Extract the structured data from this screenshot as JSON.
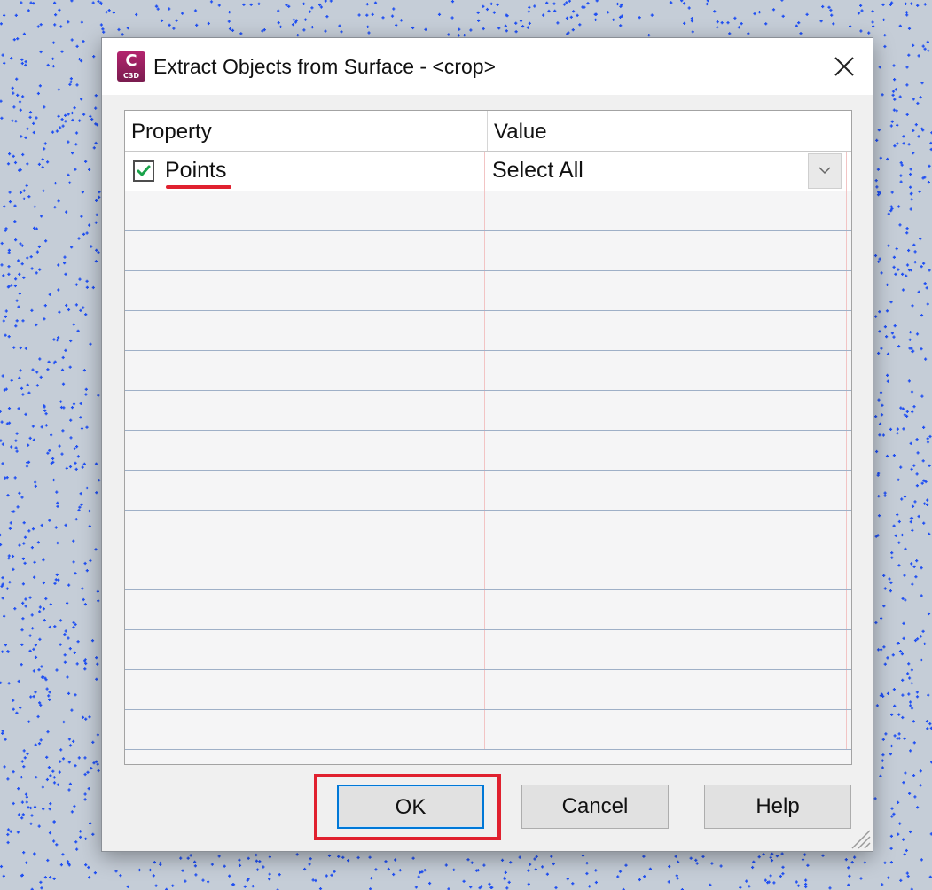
{
  "window": {
    "title": "Extract Objects from Surface - <crop>",
    "app_icon_letter": "C",
    "app_icon_badge": "C3D",
    "close_icon": "close-icon"
  },
  "grid": {
    "columns": [
      "Property",
      "Value"
    ],
    "rows": [
      {
        "property": "Points",
        "checked": true,
        "value": "Select All",
        "has_dropdown": true
      }
    ],
    "empty_rows": 14
  },
  "buttons": {
    "ok": "OK",
    "cancel": "Cancel",
    "help": "Help"
  },
  "colors": {
    "accent": "#0078d7",
    "highlight": "#e0212f",
    "checkmark": "#1aa34a",
    "backdrop_points": "#1f4ff2",
    "backdrop": "#c5cdd7"
  }
}
